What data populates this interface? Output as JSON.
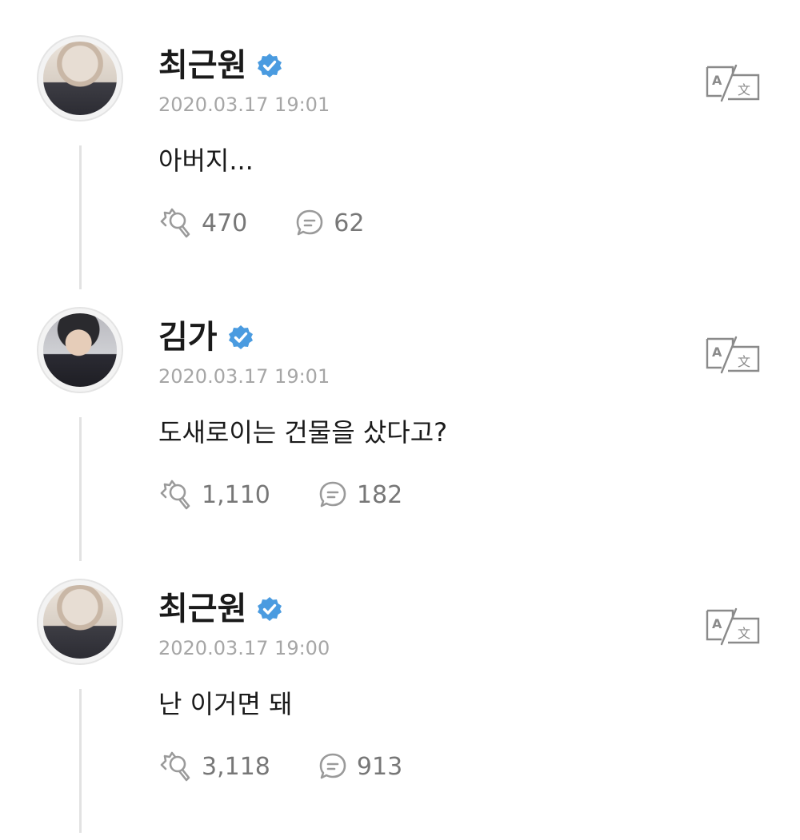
{
  "colors": {
    "verified_badge": "#4a9be0",
    "timestamp": "#a6a6a6",
    "stats_text": "#777777",
    "thread_line": "#e2e2e2"
  },
  "icons": {
    "verified": "verified-badge-icon",
    "translate": "translate-icon",
    "cheer": "cheer-icon",
    "comment": "comment-icon"
  },
  "posts": [
    {
      "author": "최근원",
      "timestamp": "2020.03.17 19:01",
      "content": "아버지...",
      "likes": "470",
      "comments": "62"
    },
    {
      "author": "김가",
      "timestamp": "2020.03.17 19:01",
      "content": "도새로이는 건물을 샀다고?",
      "likes": "1,110",
      "comments": "182"
    },
    {
      "author": "최근원",
      "timestamp": "2020.03.17 19:00",
      "content": "난 이거면 돼",
      "likes": "3,118",
      "comments": "913"
    }
  ]
}
